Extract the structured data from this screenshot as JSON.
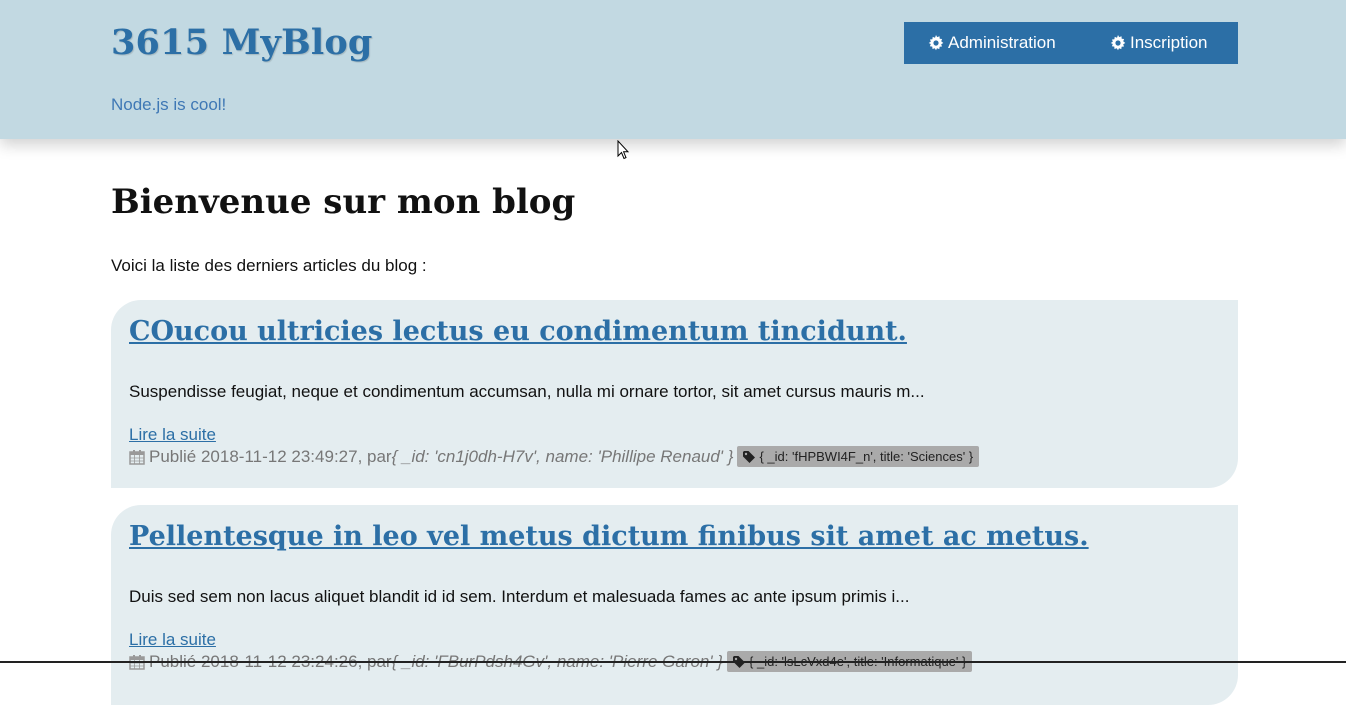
{
  "header": {
    "site_title": "3615 MyBlog",
    "tagline": "Node.js is cool!",
    "nav": [
      {
        "label": "Administration",
        "icon": "gear-icon"
      },
      {
        "label": "Inscription",
        "icon": "gear-icon"
      }
    ]
  },
  "main": {
    "title": "Bienvenue sur mon blog",
    "intro": "Voici la liste des derniers articles du blog :",
    "articles": [
      {
        "title": "COucou ultricies lectus eu condimentum tincidunt.",
        "excerpt": "Suspendisse feugiat, neque et condimentum accumsan, nulla mi ornare tortor, sit amet cursus mauris m...",
        "read_more": "Lire la suite",
        "published": "Publié 2018-11-12 23:49:27, par",
        "author": "{ _id: 'cn1j0dh-H7v', name: 'Phillipe Renaud' }",
        "tag": "{ _id: 'fHPBWI4F_n', title: 'Sciences' }"
      },
      {
        "title": "Pellentesque in leo vel metus dictum finibus sit amet ac metus.",
        "excerpt": "Duis sed sem non lacus aliquet blandit id id sem. Interdum et malesuada fames ac ante ipsum primis i...",
        "read_more": "Lire la suite",
        "published": "Publié 2018-11-12 23:24:26, par",
        "author": "{ _id: 'FBurPdsh4Gv', name: 'Pierre Garon' }",
        "tag": "{ _id: 'lsLcVxd4e', title: 'Informatique' }"
      }
    ]
  },
  "colors": {
    "header_bg": "#c2d9e2",
    "accent": "#2c6fa6",
    "article_bg": "#e4edf0",
    "tag_bg": "#aaaaaa"
  }
}
